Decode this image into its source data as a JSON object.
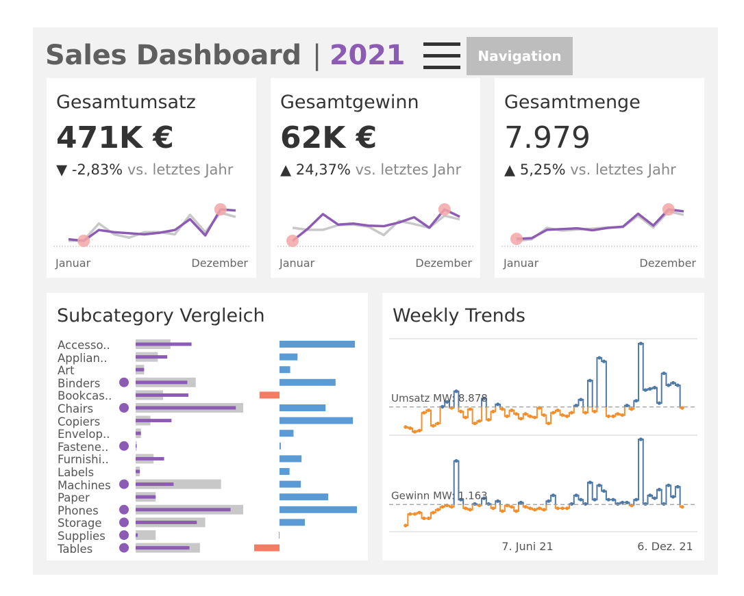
{
  "header": {
    "title": "Sales Dashboard",
    "separator": "|",
    "year": "2021",
    "nav_label": "Navigation"
  },
  "colors": {
    "purple": "#8c5bb3",
    "gray": "#c8c8c8",
    "blue": "#4e79a7",
    "bar_blue": "#5b9bd5",
    "orange": "#f28e2b",
    "negative": "#f47c64",
    "highlight": "#f4a6a6"
  },
  "kpis": [
    {
      "title": "Gesamtumsatz",
      "value": "471K €",
      "arrow": "▼",
      "pct": "-2,83%",
      "vs": "vs. letztes Jahr",
      "axis_start": "Januar",
      "axis_end": "Dezember",
      "current": [
        13.5,
        12,
        22,
        20,
        19,
        18,
        19.5,
        22,
        32,
        17,
        41,
        40
      ],
      "previous": [
        12,
        12.5,
        28,
        18,
        15,
        20,
        20,
        18,
        36,
        20,
        38,
        34
      ],
      "highlight_months": [
        2,
        11
      ]
    },
    {
      "title": "Gesamtgewinn",
      "value": "62K €",
      "arrow": "▲",
      "pct": "24,37%",
      "vs": "vs. letztes Jahr",
      "axis_start": "Januar",
      "axis_end": "Dezember",
      "current": [
        0.7,
        3,
        5.8,
        3.8,
        4,
        3.6,
        3.5,
        4.2,
        5.2,
        3.2,
        6.7,
        5.3
      ],
      "previous": [
        3.2,
        2.8,
        2.8,
        3.7,
        3.8,
        3.4,
        1.8,
        4.5,
        3.9,
        3.2,
        5.5,
        4.8
      ],
      "highlight_months": [
        1,
        11
      ]
    },
    {
      "title": "Gesamtmenge",
      "value": "7.979",
      "arrow": "▲",
      "pct": "5,25%",
      "vs": "vs. letztes Jahr",
      "axis_start": "Januar",
      "axis_end": "Dezember",
      "current": [
        340,
        360,
        570,
        590,
        610,
        560,
        620,
        650,
        980,
        680,
        1090,
        1040
      ],
      "previous": [
        290,
        330,
        620,
        550,
        580,
        600,
        630,
        640,
        930,
        630,
        1040,
        950
      ],
      "highlight_months": [
        1,
        11
      ]
    }
  ],
  "subcategory": {
    "title": "Subcategory Vergleich",
    "labels": [
      "Accesso..",
      "Applian..",
      "Art",
      "Binders",
      "Bookcas..",
      "Chairs",
      "Copiers",
      "Envelop..",
      "Fastene..",
      "Furnishi..",
      "Labels",
      "Machines",
      "Paper",
      "Phones",
      "Storage",
      "Supplies",
      "Tables"
    ],
    "flagged": [
      false,
      false,
      false,
      true,
      false,
      true,
      false,
      false,
      true,
      false,
      false,
      true,
      false,
      true,
      true,
      true,
      true
    ],
    "sales_previous": [
      33,
      21,
      8,
      57,
      26,
      102,
      14,
      5,
      1,
      17,
      4,
      81,
      19,
      102,
      66,
      19,
      61
    ],
    "sales_current": [
      53,
      30,
      8,
      49,
      50,
      95,
      34,
      5,
      1,
      27,
      4,
      36,
      19,
      90,
      58,
      2,
      51
    ],
    "profit": [
      113,
      27,
      16,
      84,
      -30,
      69,
      110,
      21,
      2,
      33,
      15,
      32,
      73,
      116,
      38,
      -1,
      -38
    ]
  },
  "weekly": {
    "title": "Weekly Trends",
    "umsatz_label": "Umsatz MW: 8.878",
    "gewinn_label": "Gewinn MW: 1.163",
    "axis_ticks": [
      "7. Juni 21",
      "6. Dez. 21"
    ],
    "umsatz_mean": 8878,
    "gewinn_mean": 1163,
    "umsatz": [
      7200,
      7100,
      6800,
      6900,
      8400,
      8600,
      7300,
      7500,
      8900,
      9300,
      8800,
      10200,
      8500,
      8000,
      8700,
      7500,
      7700,
      9600,
      7800,
      8500,
      9100,
      8700,
      8100,
      8600,
      8300,
      7900,
      8300,
      8100,
      8000,
      8800,
      8200,
      7500,
      8400,
      8600,
      8200,
      8100,
      8400,
      9000,
      9500,
      8400,
      11100,
      8500,
      13000,
      12700,
      8100,
      8100,
      8300,
      8200,
      9000,
      8700,
      9400,
      14200,
      10300,
      10400,
      10500,
      9200,
      11700,
      10700,
      10900,
      10700,
      8800
    ],
    "gewinn": [
      -300,
      500,
      500,
      600,
      200,
      200,
      600,
      800,
      1000,
      1100,
      1000,
      4200,
      1500,
      900,
      800,
      1200,
      1100,
      1600,
      1200,
      900,
      1400,
      700,
      1100,
      1000,
      700,
      1300,
      1000,
      900,
      800,
      900,
      800,
      1400,
      1800,
      900,
      900,
      900,
      1200,
      1800,
      1500,
      1200,
      2700,
      1500,
      2500,
      2100,
      1500,
      1500,
      1200,
      1300,
      1300,
      1100,
      1500,
      5700,
      1200,
      1800,
      1600,
      2200,
      1200,
      2500,
      1700,
      2400,
      1000
    ]
  }
}
